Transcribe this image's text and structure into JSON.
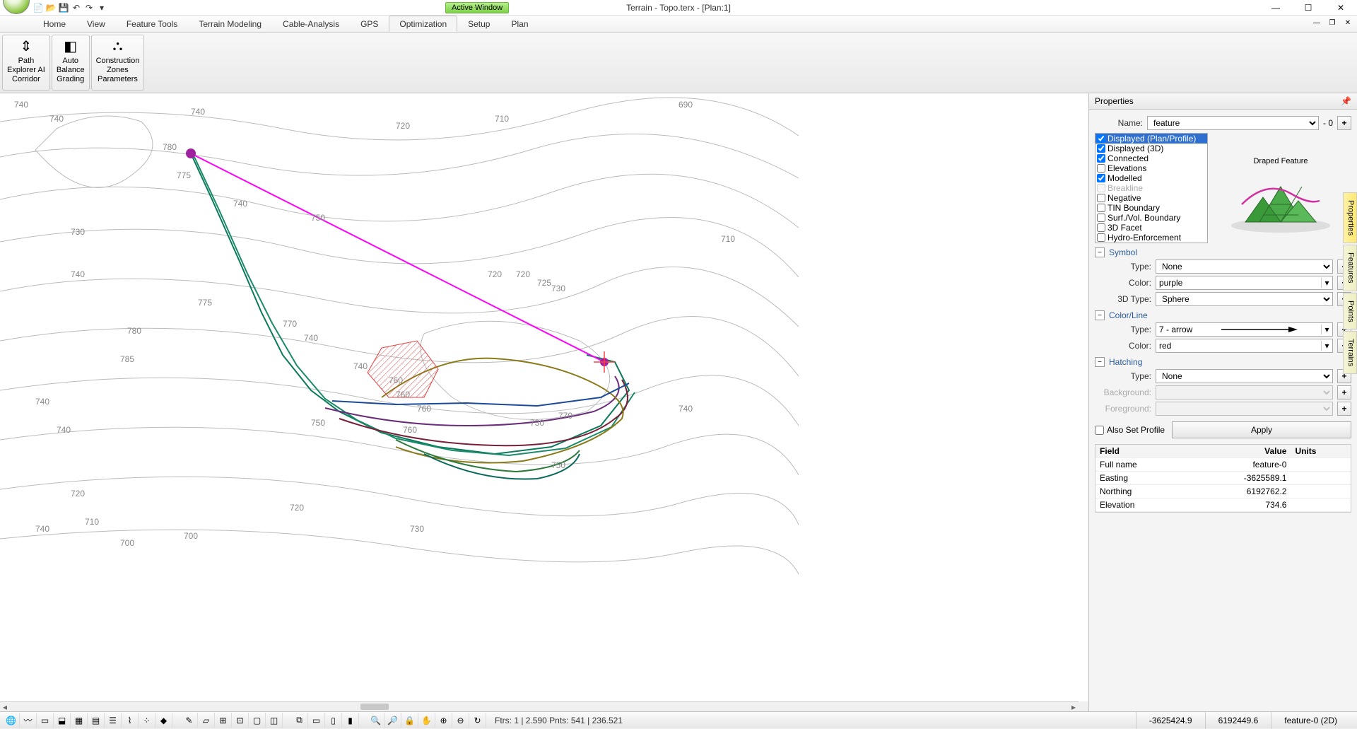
{
  "window": {
    "title": "Terrain - Topo.terx - [Plan:1]",
    "active_window_label": "Active Window"
  },
  "menu": {
    "tabs": [
      "Home",
      "View",
      "Feature Tools",
      "Terrain Modeling",
      "Cable-Analysis",
      "GPS",
      "Optimization",
      "Setup",
      "Plan"
    ],
    "active_index": 6
  },
  "ribbon": {
    "groups": [
      {
        "label_l1": "Path",
        "label_l2": "Explorer AI",
        "label_l3": "Corridor",
        "icon": "⇕"
      },
      {
        "label_l1": "Auto",
        "label_l2": "Balance",
        "label_l3": "Grading",
        "icon": "◧"
      },
      {
        "label_l1": "Construction",
        "label_l2": "Zones",
        "label_l3": "Parameters",
        "icon": "⛬"
      }
    ]
  },
  "properties": {
    "panel_title": "Properties",
    "name_label": "Name:",
    "name_value": "feature",
    "name_index": "- 0",
    "checklist": [
      {
        "label": "Displayed (Plan/Profile)",
        "checked": true,
        "selected": true
      },
      {
        "label": "Displayed (3D)",
        "checked": true
      },
      {
        "label": "Connected",
        "checked": true
      },
      {
        "label": "Elevations",
        "checked": false
      },
      {
        "label": "Modelled",
        "checked": true
      },
      {
        "label": "Breakline",
        "checked": false,
        "disabled": true
      },
      {
        "label": "Negative",
        "checked": false
      },
      {
        "label": "TIN Boundary",
        "checked": false
      },
      {
        "label": "Surf./Vol. Boundary",
        "checked": false
      },
      {
        "label": "3D Facet",
        "checked": false
      },
      {
        "label": "Hydro-Enforcement",
        "checked": false
      }
    ],
    "draped_caption": "Draped Feature",
    "sections": {
      "symbol": {
        "title": "Symbol",
        "type_label": "Type:",
        "type_value": "None",
        "color_label": "Color:",
        "color_name": "purple",
        "color_hex": "#800080",
        "type3d_label": "3D Type:",
        "type3d_value": "Sphere"
      },
      "colorline": {
        "title": "Color/Line",
        "type_label": "Type:",
        "type_value": "7 - arrow",
        "color_label": "Color:",
        "color_name": "red",
        "color_hex": "#ff0000"
      },
      "hatching": {
        "title": "Hatching",
        "type_label": "Type:",
        "type_value": "None",
        "bg_label": "Background:",
        "fg_label": "Foreground:"
      }
    },
    "also_set_profile_label": "Also Set Profile",
    "apply_label": "Apply",
    "grid": {
      "headers": [
        "Field",
        "Value",
        "Units"
      ],
      "rows": [
        {
          "field": "Full name",
          "value": "feature-0",
          "units": ""
        },
        {
          "field": "Easting",
          "value": "-3625589.1",
          "units": ""
        },
        {
          "field": "Northing",
          "value": "6192762.2",
          "units": ""
        },
        {
          "field": "Elevation",
          "value": "734.6",
          "units": ""
        }
      ]
    }
  },
  "sidetabs": [
    "Properties",
    "Features",
    "Points",
    "Terrains"
  ],
  "status": {
    "info": "Ftrs: 1 | 2.590  Pnts: 541 | 236.521",
    "coord1": "-3625424.9",
    "coord2": "6192449.6",
    "coord3": "feature-0 (2D)"
  },
  "contour_labels": [
    "740",
    "740",
    "740",
    "775",
    "780",
    "710",
    "720",
    "690",
    "740",
    "750",
    "720",
    "720",
    "725",
    "730",
    "710",
    "740",
    "740",
    "760",
    "775",
    "780",
    "785",
    "770",
    "760",
    "760",
    "740",
    "740",
    "750",
    "730",
    "760",
    "770",
    "750",
    "740",
    "740",
    "720",
    "710",
    "700",
    "700",
    "720",
    "730",
    "740",
    "730"
  ]
}
